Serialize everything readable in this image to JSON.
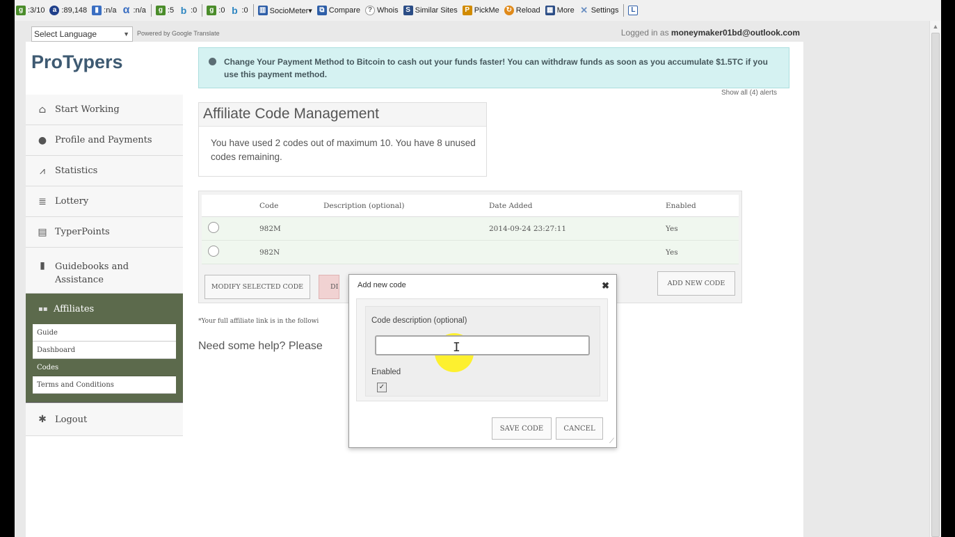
{
  "toolbar": {
    "items": [
      {
        "text": ":3/10",
        "icon": "google-rank-icon",
        "color": "#4a8c2a"
      },
      {
        "text": ":89,148",
        "icon": "alexa-rank-icon",
        "color": "#1f3f8a"
      },
      {
        "text": ":n/a",
        "icon": "majestic-icon",
        "color": "#3b6fc2"
      },
      {
        "text": ":n/a",
        "icon": "alpha-icon",
        "color": "#3b6fc2"
      },
      {
        "text": ":5",
        "icon": "google-index-icon",
        "color": "#4a8c2a"
      },
      {
        "text": ":0",
        "icon": "bing-index-icon",
        "color": "#2e86c1"
      },
      {
        "text": ":0",
        "icon": "google-links-icon",
        "color": "#4a8c2a"
      },
      {
        "text": ":0",
        "icon": "bing-links-icon",
        "color": "#2e86c1"
      }
    ],
    "links": [
      {
        "label": "SocioMeter▾",
        "icon": "sociometer-icon",
        "color": "#2f5fa8"
      },
      {
        "label": "Compare",
        "icon": "compare-icon",
        "color": "#2f5fa8"
      },
      {
        "label": "Whois",
        "icon": "whois-icon",
        "color": "#666666"
      },
      {
        "label": "Similar Sites",
        "icon": "similar-sites-icon",
        "color": "#2b4d86"
      },
      {
        "label": "PickMe",
        "icon": "pickme-icon",
        "color": "#d18b00"
      },
      {
        "label": "Reload",
        "icon": "reload-icon",
        "color": "#e08a1a"
      },
      {
        "label": "More",
        "icon": "more-icon",
        "color": "#2b4d86"
      },
      {
        "label": "Settings",
        "icon": "settings-icon",
        "color": "#6a8fc2"
      }
    ]
  },
  "lang": {
    "select": "Select Language",
    "powered": "Powered by Google Translate"
  },
  "user": {
    "prefix": "Logged in as ",
    "email": "moneymaker01bd@outlook.com"
  },
  "brand": "ProTypers",
  "nav": {
    "start": "Start Working",
    "profile": "Profile and Payments",
    "statistics": "Statistics",
    "lottery": "Lottery",
    "typerpoints": "TyperPoints",
    "guidebooks": "Guidebooks and Assistance",
    "affiliates": "Affiliates",
    "sub": {
      "guide": "Guide",
      "dashboard": "Dashboard",
      "codes": "Codes",
      "terms": "Terms and Conditions"
    },
    "logout": "Logout"
  },
  "alert": {
    "text": "Change Your Payment Method to Bitcoin to cash out your funds faster! You can withdraw funds as soon as you accumulate $1.5TC if you use this payment method.",
    "show_all": "Show all (4) alerts"
  },
  "affiliate": {
    "title": "Affiliate Code Management",
    "body": "You have used 2 codes out of maximum 10. You have 8 unused codes remaining."
  },
  "table": {
    "headers": [
      "",
      "Code",
      "Description (optional)",
      "Date Added",
      "Enabled"
    ],
    "rows": [
      {
        "code": "982M",
        "description": "",
        "date": "2014-09-24 23:27:11",
        "enabled": "Yes"
      },
      {
        "code": "982N",
        "description": "",
        "date": "",
        "enabled": "Yes"
      }
    ]
  },
  "buttons": {
    "modify": "MODIFY SELECTED CODE",
    "delete": "DI",
    "add": "ADD NEW CODE"
  },
  "note": "*Your full affiliate link is in the followi",
  "help": "Need some help? Please",
  "modal": {
    "title": "Add new code",
    "desc_label": "Code description (optional)",
    "desc_value": "",
    "enabled_label": "Enabled",
    "enabled_checked": true,
    "save": "SAVE CODE",
    "cancel": "CANCEL"
  }
}
